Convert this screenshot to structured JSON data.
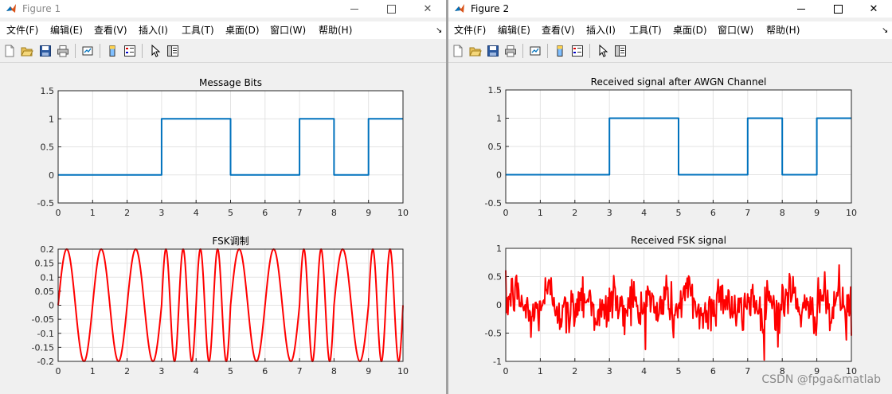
{
  "windows": [
    {
      "title": "Figure 1",
      "menu": [
        "文件(F)",
        "编辑(E)",
        "查看(V)",
        "插入(I)",
        "工具(T)",
        "桌面(D)",
        "窗口(W)",
        "帮助(H)"
      ],
      "axes": [
        {
          "title": "Message Bits",
          "chart_data": {
            "type": "line",
            "title": "Message Bits",
            "xlim": [
              0,
              10
            ],
            "ylim": [
              -0.5,
              1.5
            ],
            "xticks": [
              "0",
              "1",
              "2",
              "3",
              "4",
              "5",
              "6",
              "7",
              "8",
              "9",
              "10"
            ],
            "yticks": [
              "-0.5",
              "0",
              "0.5",
              "1",
              "1.5"
            ],
            "grid": true,
            "series": [
              {
                "color": "#0072bd",
                "step": true,
                "x": [
                  0,
                  3,
                  3,
                  5,
                  5,
                  7,
                  7,
                  8,
                  8,
                  9,
                  9,
                  10
                ],
                "y": [
                  0,
                  0,
                  1,
                  1,
                  0,
                  0,
                  1,
                  1,
                  0,
                  0,
                  1,
                  1
                ]
              }
            ]
          }
        },
        {
          "title": "FSK调制",
          "chart_data": {
            "type": "line",
            "title": "FSK调制",
            "xlim": [
              0,
              10
            ],
            "ylim": [
              -0.2,
              0.2
            ],
            "xticks": [
              "0",
              "1",
              "2",
              "3",
              "4",
              "5",
              "6",
              "7",
              "8",
              "9",
              "10"
            ],
            "yticks": [
              "-0.2",
              "-0.15",
              "-0.1",
              "-0.05",
              "0",
              "0.05",
              "0.1",
              "0.15",
              "0.2"
            ],
            "grid": true,
            "signal": {
              "kind": "fsk",
              "amplitude": 0.2,
              "bits": [
                0,
                0,
                0,
                1,
                1,
                0,
                0,
                1,
                0,
                1
              ],
              "cycles_per_bit_0": 1,
              "cycles_per_bit_1": 2
            },
            "series": [
              {
                "color": "#ff0000"
              }
            ]
          }
        }
      ]
    },
    {
      "title": "Figure 2",
      "menu": [
        "文件(F)",
        "编辑(E)",
        "查看(V)",
        "插入(I)",
        "工具(T)",
        "桌面(D)",
        "窗口(W)",
        "帮助(H)"
      ],
      "axes": [
        {
          "title": "Received signal after AWGN Channel",
          "chart_data": {
            "type": "line",
            "title": "Received signal after AWGN Channel",
            "xlim": [
              0,
              10
            ],
            "ylim": [
              -0.5,
              1.5
            ],
            "xticks": [
              "0",
              "1",
              "2",
              "3",
              "4",
              "5",
              "6",
              "7",
              "8",
              "9",
              "10"
            ],
            "yticks": [
              "-0.5",
              "0",
              "0.5",
              "1",
              "1.5"
            ],
            "grid": true,
            "series": [
              {
                "color": "#0072bd",
                "step": true,
                "x": [
                  0,
                  3,
                  3,
                  5,
                  5,
                  7,
                  7,
                  8,
                  8,
                  9,
                  9,
                  10
                ],
                "y": [
                  0,
                  0,
                  1,
                  1,
                  0,
                  0,
                  1,
                  1,
                  0,
                  0,
                  1,
                  1
                ]
              }
            ]
          }
        },
        {
          "title": "Received FSK signal",
          "chart_data": {
            "type": "line",
            "title": "Received FSK signal",
            "xlim": [
              0,
              10
            ],
            "ylim": [
              -1,
              1
            ],
            "xticks": [
              "0",
              "1",
              "2",
              "3",
              "4",
              "5",
              "6",
              "7",
              "8",
              "9",
              "10"
            ],
            "yticks": [
              "-1",
              "-0.5",
              "0",
              "0.5",
              "1"
            ],
            "grid": true,
            "signal": {
              "kind": "fsk_noisy",
              "amplitude": 0.2,
              "bits": [
                0,
                0,
                0,
                1,
                1,
                0,
                0,
                1,
                0,
                1
              ],
              "cycles_per_bit_0": 1,
              "cycles_per_bit_1": 2,
              "noise_std": 0.22
            },
            "series": [
              {
                "color": "#ff0000"
              }
            ]
          }
        }
      ]
    }
  ],
  "watermark": "CSDN @fpga&matlab"
}
